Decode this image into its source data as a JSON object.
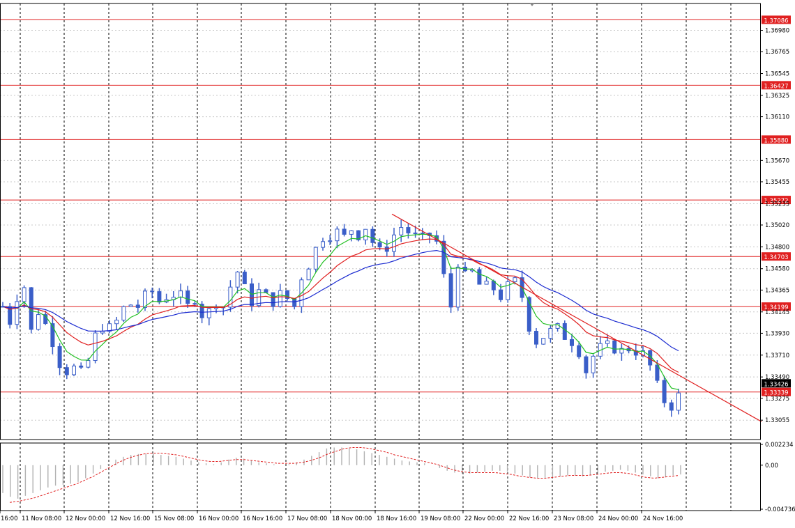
{
  "chart_data": [
    {
      "type": "candlestick",
      "title": "",
      "ylim": [
        1.3286,
        1.3718
      ],
      "y_ticks": [
        "1.36980",
        "1.36765",
        "1.36545",
        "1.36325",
        "1.36110",
        "1.35670",
        "1.35455",
        "1.35235",
        "1.35020",
        "1.34800",
        "1.34580",
        "1.34365",
        "1.34145",
        "1.33930",
        "1.33710",
        "1.33490",
        "1.33275",
        "1.33055"
      ],
      "x_ticks": [
        "16:00",
        "11 Nov 08:00",
        "12 Nov 00:00",
        "12 Nov 16:00",
        "15 Nov 08:00",
        "16 Nov 00:00",
        "16 Nov 16:00",
        "17 Nov 08:00",
        "18 Nov 00:00",
        "18 Nov 16:00",
        "19 Nov 08:00",
        "22 Nov 00:00",
        "22 Nov 16:00",
        "23 Nov 08:00",
        "24 Nov 00:00",
        "24 Nov 16:00"
      ],
      "price_levels": [
        "1.37086",
        "1.36427",
        "1.35880",
        "1.35272",
        "1.34703",
        "1.34199",
        "1.33339"
      ],
      "current_price": "1.33426",
      "colors": {
        "candles": "#3a5ec8",
        "levels": "#e02020",
        "ma_fast": "#22c022",
        "ma_mid": "#e02020",
        "ma_slow": "#1a2ad0",
        "trendline": "#e02020",
        "grid": "#000000"
      },
      "close_path": [
        [
          0,
          1.342
        ],
        [
          10,
          1.3405
        ],
        [
          20,
          1.343
        ],
        [
          30,
          1.344
        ],
        [
          40,
          1.3395
        ],
        [
          50,
          1.3415
        ],
        [
          60,
          1.3402
        ],
        [
          70,
          1.3385
        ],
        [
          80,
          1.3363
        ],
        [
          90,
          1.3355
        ],
        [
          100,
          1.3358
        ],
        [
          110,
          1.3353
        ],
        [
          120,
          1.3365
        ],
        [
          130,
          1.339
        ],
        [
          140,
          1.34
        ],
        [
          150,
          1.3398
        ],
        [
          160,
          1.3405
        ],
        [
          170,
          1.3418
        ],
        [
          180,
          1.3422
        ],
        [
          190,
          1.342
        ],
        [
          200,
          1.343
        ],
        [
          210,
          1.3435
        ],
        [
          220,
          1.3425
        ],
        [
          230,
          1.343
        ],
        [
          240,
          1.3432
        ],
        [
          250,
          1.343
        ],
        [
          260,
          1.342
        ],
        [
          270,
          1.3428
        ],
        [
          280,
          1.3412
        ],
        [
          290,
          1.3415
        ],
        [
          300,
          1.3425
        ],
        [
          310,
          1.342
        ],
        [
          320,
          1.344
        ],
        [
          330,
          1.3455
        ],
        [
          340,
          1.3438
        ],
        [
          350,
          1.3425
        ],
        [
          360,
          1.3435
        ],
        [
          370,
          1.343
        ],
        [
          380,
          1.3425
        ],
        [
          390,
          1.3432
        ],
        [
          400,
          1.3428
        ],
        [
          410,
          1.342
        ],
        [
          420,
          1.345
        ],
        [
          430,
          1.3462
        ],
        [
          440,
          1.3478
        ],
        [
          450,
          1.349
        ],
        [
          460,
          1.3492
        ],
        [
          470,
          1.3495
        ],
        [
          480,
          1.349
        ],
        [
          490,
          1.3498
        ],
        [
          500,
          1.3492
        ],
        [
          510,
          1.35
        ],
        [
          520,
          1.3485
        ],
        [
          530,
          1.3475
        ],
        [
          540,
          1.348
        ],
        [
          550,
          1.3492
        ],
        [
          560,
          1.35
        ],
        [
          570,
          1.3495
        ],
        [
          580,
          1.349
        ],
        [
          590,
          1.3488
        ],
        [
          600,
          1.3492
        ],
        [
          610,
          1.3485
        ],
        [
          620,
          1.345
        ],
        [
          630,
          1.342
        ],
        [
          640,
          1.3465
        ],
        [
          650,
          1.345
        ],
        [
          660,
          1.3455
        ],
        [
          670,
          1.3442
        ],
        [
          680,
          1.344
        ],
        [
          690,
          1.3438
        ],
        [
          700,
          1.343
        ],
        [
          710,
          1.344
        ],
        [
          720,
          1.3445
        ],
        [
          730,
          1.343
        ],
        [
          740,
          1.34
        ],
        [
          750,
          1.3385
        ],
        [
          760,
          1.339
        ],
        [
          770,
          1.3395
        ],
        [
          780,
          1.3398
        ],
        [
          790,
          1.339
        ],
        [
          800,
          1.3385
        ],
        [
          810,
          1.3375
        ],
        [
          820,
          1.3355
        ],
        [
          830,
          1.337
        ],
        [
          840,
          1.3378
        ],
        [
          850,
          1.338
        ],
        [
          860,
          1.3378
        ],
        [
          870,
          1.3375
        ],
        [
          880,
          1.3378
        ],
        [
          890,
          1.3375
        ],
        [
          900,
          1.3372
        ],
        [
          910,
          1.336
        ],
        [
          920,
          1.334
        ],
        [
          930,
          1.3325
        ],
        [
          940,
          1.332
        ],
        [
          950,
          1.333
        ],
        [
          960,
          1.3328
        ],
        [
          970,
          1.3345
        ],
        [
          980,
          1.3342
        ],
        [
          990,
          1.3345
        ]
      ]
    },
    {
      "type": "histogram",
      "title": "",
      "ylim": [
        -0.004736,
        0.002234
      ],
      "y_ticks": [
        "0.002234",
        "0.00",
        "-0.004736"
      ],
      "values": [
        -0.003,
        -0.0034,
        -0.0036,
        -0.0033,
        -0.003,
        -0.0027,
        -0.0024,
        -0.0022,
        -0.0021,
        -0.002,
        -0.0018,
        -0.0014,
        -0.0009,
        -0.0004,
        0.0001,
        0.0006,
        0.0009,
        0.0011,
        0.0012,
        0.0012,
        0.0012,
        0.0011,
        0.001,
        0.0009,
        0.0007,
        0.0005,
        0.0003,
        0.0002,
        0.0001,
        0.0003,
        0.0006,
        0.0008,
        0.0007,
        0.0005,
        0.0003,
        0.0002,
        0.0001,
        0.0,
        0.0001,
        0.0003,
        0.0006,
        0.001,
        0.0014,
        0.0018,
        0.0019,
        0.0019,
        0.0018,
        0.0017,
        0.0015,
        0.0013,
        0.0011,
        0.0009,
        0.0007,
        0.0005,
        0.0004,
        0.0003,
        0.0002,
        0.0,
        -0.0003,
        -0.0006,
        -0.0008,
        -0.0009,
        -0.0009,
        -0.0008,
        -0.0007,
        -0.0006,
        -0.0006,
        -0.0007,
        -0.0009,
        -0.0011,
        -0.0013,
        -0.0014,
        -0.0014,
        -0.0013,
        -0.0012,
        -0.0011,
        -0.0011,
        -0.0012,
        -0.0011,
        -0.0009,
        -0.0007,
        -0.0006,
        -0.0005,
        -0.0006,
        -0.0008,
        -0.001,
        -0.0012,
        -0.0014,
        -0.0013,
        -0.0011,
        -0.001
      ],
      "signal": [
        -0.004,
        -0.0039,
        -0.0037,
        -0.0035,
        -0.0032,
        -0.0029,
        -0.0026,
        -0.0023,
        -0.002,
        -0.0016,
        -0.0012,
        -0.0007,
        -0.0002,
        0.0003,
        0.0007,
        0.001,
        0.0012,
        0.0013,
        0.0013,
        0.0012,
        0.0011,
        0.0009,
        0.0007,
        0.0005,
        0.0004,
        0.0004,
        0.0005,
        0.0006,
        0.0006,
        0.0005,
        0.0004,
        0.0003,
        0.0002,
        0.0002,
        0.0002,
        0.0003,
        0.0005,
        0.0008,
        0.0012,
        0.0015,
        0.0018,
        0.0019,
        0.0019,
        0.0018,
        0.0016,
        0.0014,
        0.0011,
        0.0009,
        0.0007,
        0.0005,
        0.0003,
        0.0001,
        -0.0002,
        -0.0005,
        -0.0007,
        -0.0008,
        -0.0008,
        -0.0008,
        -0.0008,
        -0.0009,
        -0.001,
        -0.0012,
        -0.0013,
        -0.0014,
        -0.0014,
        -0.0013,
        -0.0012,
        -0.0011,
        -0.0011,
        -0.0011,
        -0.001,
        -0.0009,
        -0.0008,
        -0.0008,
        -0.0009,
        -0.0011,
        -0.0013,
        -0.0014,
        -0.0013,
        -0.0012,
        -0.0011
      ]
    }
  ]
}
